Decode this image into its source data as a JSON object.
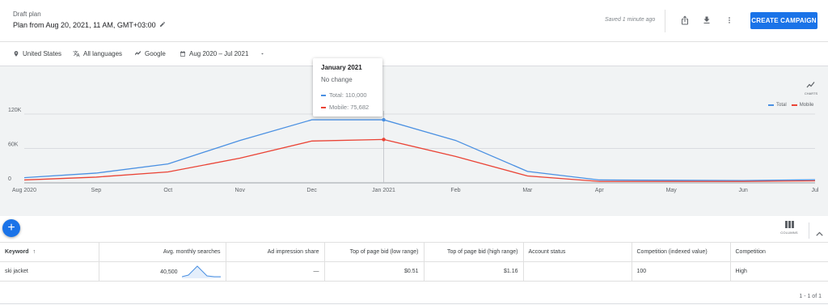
{
  "header": {
    "draft_label": "Draft plan",
    "plan_title": "Plan from Aug 20, 2021, 11 AM, GMT+03:00",
    "saved_status": "Saved 1 minute ago",
    "create_button": "CREATE CAMPAIGN"
  },
  "filters": {
    "location": "United States",
    "language": "All languages",
    "network": "Google",
    "date_range": "Aug 2020 – Jul 2021"
  },
  "tooltip": {
    "title": "January 2021",
    "subtitle": "No change",
    "total": "Total: 110,000",
    "mobile": "Mobile: 75,682"
  },
  "chart_controls": {
    "charts_label": "CHARTS",
    "legend_total": "Total",
    "legend_mobile": "Mobile"
  },
  "chart_data": {
    "type": "line",
    "x": [
      "Aug 2020",
      "Sep",
      "Oct",
      "Nov",
      "Dec",
      "Jan 2021",
      "Feb",
      "Mar",
      "Apr",
      "May",
      "Jun",
      "Jul"
    ],
    "ylim": [
      0,
      120000
    ],
    "y_ticks": [
      "0",
      "60K",
      "120K"
    ],
    "grid": true,
    "legend": "top-right",
    "series": [
      {
        "name": "Total",
        "color": "#4a90e2",
        "values": [
          9000,
          17000,
          33000,
          74000,
          110000,
          110000,
          74000,
          20000,
          5000,
          4500,
          4000,
          5500
        ]
      },
      {
        "name": "Mobile",
        "color": "#ea4335",
        "values": [
          5000,
          10000,
          19000,
          43000,
          73000,
          75682,
          46000,
          12000,
          2500,
          2500,
          2500,
          3500
        ]
      }
    ],
    "highlight_index": 5
  },
  "table": {
    "columns_label": "COLUMNS",
    "headers": [
      "Keyword",
      "Avg. monthly searches",
      "Ad impression share",
      "Top of page bid (low range)",
      "Top of page bid (high range)",
      "Account status",
      "Competition (indexed value)",
      "Competition"
    ],
    "rows": [
      {
        "keyword": "ski jacket",
        "avg_searches": "40,500",
        "ad_share": "—",
        "bid_low": "$0.51",
        "bid_high": "$1.16",
        "account_status": "",
        "competition_index": "100",
        "competition": "High"
      }
    ],
    "pagination": "1 - 1 of 1"
  },
  "colors": {
    "accent": "#1a73e8",
    "total": "#4a90e2",
    "mobile": "#ea4335"
  }
}
